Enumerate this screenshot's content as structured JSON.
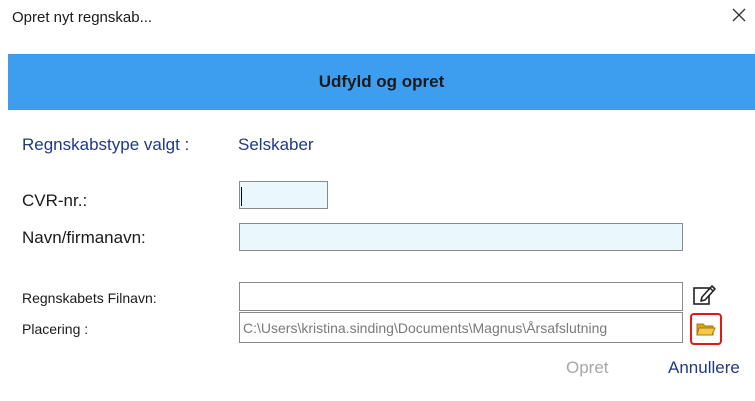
{
  "window": {
    "title": "Opret nyt regnskab...",
    "close_icon": "close-icon"
  },
  "banner": {
    "text": "Udfyld og opret",
    "color": "#3d9ef0"
  },
  "type": {
    "label": "Regnskabstype valgt :",
    "value": "Selskaber"
  },
  "fields": {
    "cvr": {
      "label": "CVR-nr.:",
      "value": ""
    },
    "name": {
      "label": "Navn/firmanavn:",
      "value": ""
    },
    "filename": {
      "label": "Regnskabets Filnavn:",
      "value": "",
      "icon": "edit-icon"
    },
    "location": {
      "label": "Placering :",
      "value": "C:\\Users\\kristina.sinding\\Documents\\Magnus\\Årsafslutning",
      "icon": "folder-icon"
    }
  },
  "buttons": {
    "ok": "Opret",
    "cancel": "Annullere"
  },
  "colors": {
    "accent": "#3d9ef0",
    "link": "#1f3a80",
    "highlight": "#e01818"
  }
}
